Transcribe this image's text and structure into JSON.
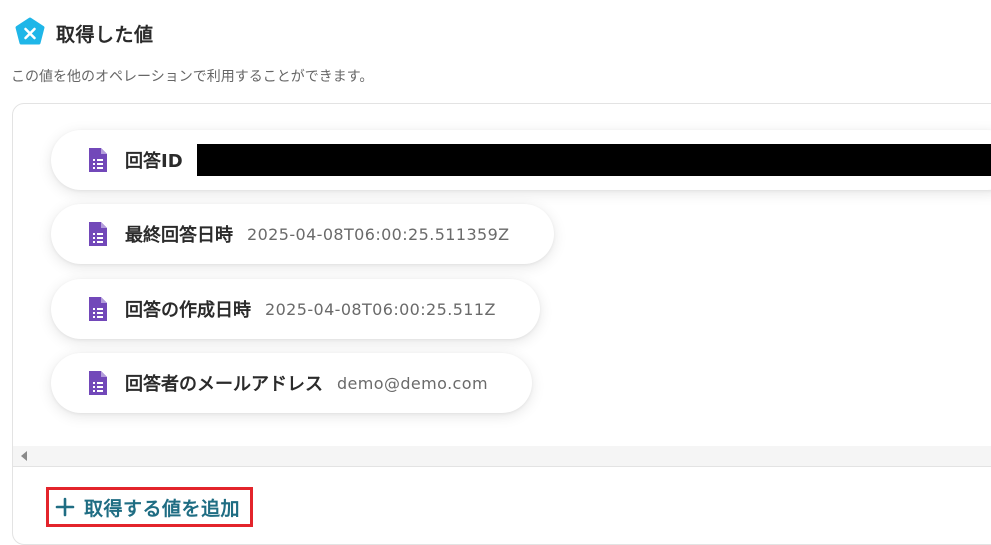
{
  "header": {
    "logo_icon": "yoom-logo-icon",
    "title": "取得した値"
  },
  "description": "この値を他のオペレーションで利用することができます。",
  "fields": [
    {
      "label": "回答ID",
      "value": "",
      "redacted": true,
      "icon": "google-forms-icon"
    },
    {
      "label": "最終回答日時",
      "value": "2025-04-08T06:00:25.511359Z",
      "redacted": false,
      "icon": "google-forms-icon"
    },
    {
      "label": "回答の作成日時",
      "value": "2025-04-08T06:00:25.511Z",
      "redacted": false,
      "icon": "google-forms-icon"
    },
    {
      "label": "回答者のメールアドレス",
      "value": "demo@demo.com",
      "redacted": false,
      "icon": "google-forms-icon"
    }
  ],
  "add_button": {
    "label": "取得する値を追加",
    "icon": "plus-icon"
  },
  "colors": {
    "brand": "#1fb6e8",
    "forms_purple": "#7248b9",
    "link_teal": "#1f6d83",
    "highlight_red": "#e3242b"
  }
}
